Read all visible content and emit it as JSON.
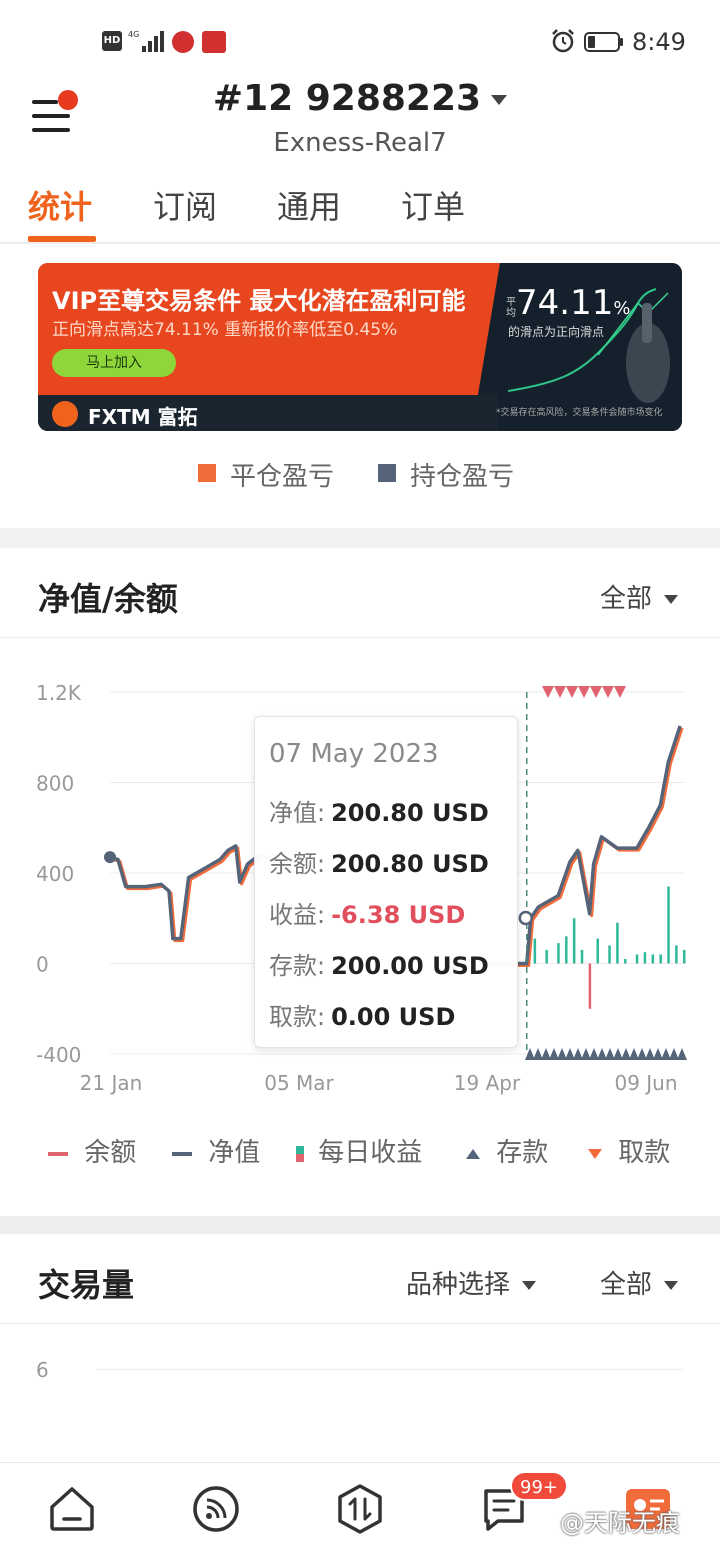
{
  "status_bar": {
    "hd": "HD",
    "net": "4G",
    "time": "8:49"
  },
  "header": {
    "account": "#12 9288223",
    "server": "Exness-Real7",
    "menu_has_notification": true
  },
  "tabs": [
    {
      "label": "统计",
      "active": true
    },
    {
      "label": "订阅",
      "active": false
    },
    {
      "label": "通用",
      "active": false
    },
    {
      "label": "订单",
      "active": false
    }
  ],
  "banner": {
    "title": "VIP至尊交易条件 最大化潜在盈利可能",
    "subtitle": "正向滑点高达74.11% 重新报价率低至0.45%",
    "cta": "马上加入",
    "brand": "FXTM 富拓",
    "pct_prefix": "平均",
    "pct": "74.11",
    "pct_unit": "%",
    "pct_desc": "的滑点为正向滑点",
    "disclaimer": "*交易存在高风险，交易条件会随市场变化"
  },
  "pnl_legend": [
    {
      "label": "平仓盈亏",
      "color": "#f26b3a"
    },
    {
      "label": "持仓盈亏",
      "color": "#56647a"
    }
  ],
  "equity_section": {
    "title": "净值/余额",
    "filter": "全部"
  },
  "tooltip": {
    "date": "07 May 2023",
    "rows": [
      {
        "label": "净值:",
        "value": "200.80 USD",
        "negative": false
      },
      {
        "label": "余额:",
        "value": "200.80 USD",
        "negative": false
      },
      {
        "label": "收益:",
        "value": "-6.38 USD",
        "negative": true
      },
      {
        "label": "存款:",
        "value": "200.00 USD",
        "negative": false
      },
      {
        "label": "取款:",
        "value": "0.00 USD",
        "negative": false
      }
    ]
  },
  "chart_legend": [
    {
      "label": "余额",
      "color": "#e0646e"
    },
    {
      "label": "净值",
      "color": "#56647a"
    },
    {
      "label": "每日收益",
      "color": "#2fb89a"
    },
    {
      "label": "存款",
      "color": "#56647a"
    },
    {
      "label": "取款",
      "color": "#f26b3a"
    }
  ],
  "volume_section": {
    "title": "交易量",
    "symbol_filter": "品种选择",
    "filter": "全部",
    "y_top": "6"
  },
  "bottom_nav": {
    "badge": "99+",
    "watermark": "@天际无痕"
  },
  "chart_data": {
    "type": "line",
    "title": "净值/余额",
    "y_ticks": [
      "1.2K",
      "800",
      "400",
      "0",
      "-400"
    ],
    "x_ticks": [
      "21 Jan",
      "05 Mar",
      "19 Apr",
      "09 Jun"
    ],
    "ylim": [
      -400,
      1200
    ],
    "series": [
      {
        "name": "净值",
        "x": [
          "2023-01-21",
          "2023-01-23",
          "2023-01-25",
          "2023-01-30",
          "2023-02-03",
          "2023-02-05",
          "2023-02-06",
          "2023-02-08",
          "2023-02-10",
          "2023-02-14",
          "2023-02-18",
          "2023-02-20",
          "2023-02-22",
          "2023-02-23",
          "2023-02-25",
          "2023-02-28",
          "2023-03-02",
          "2023-03-05"
        ],
        "values": [
          470,
          460,
          340,
          340,
          350,
          320,
          110,
          110,
          380,
          420,
          460,
          500,
          520,
          360,
          440,
          480,
          470,
          460
        ]
      },
      {
        "name": "净值",
        "x": [
          "2023-04-26",
          "2023-05-07",
          "2023-05-08",
          "2023-05-10",
          "2023-05-15",
          "2023-05-18",
          "2023-05-20",
          "2023-05-23",
          "2023-05-24",
          "2023-05-26",
          "2023-05-30",
          "2023-06-04",
          "2023-06-07",
          "2023-06-10",
          "2023-06-12",
          "2023-06-15"
        ],
        "values": [
          0,
          0,
          201,
          250,
          300,
          450,
          500,
          220,
          440,
          560,
          510,
          510,
          600,
          700,
          890,
          1050
        ]
      }
    ],
    "daily_profit": {
      "x": [
        "2023-05-07",
        "2023-05-09",
        "2023-05-12",
        "2023-05-15",
        "2023-05-17",
        "2023-05-19",
        "2023-05-21",
        "2023-05-23",
        "2023-05-25",
        "2023-05-28",
        "2023-05-30",
        "2023-06-01",
        "2023-06-04",
        "2023-06-06",
        "2023-06-08",
        "2023-06-10",
        "2023-06-12",
        "2023-06-14",
        "2023-06-16"
      ],
      "values": [
        -6,
        110,
        60,
        90,
        120,
        200,
        60,
        -200,
        110,
        80,
        180,
        20,
        40,
        50,
        40,
        40,
        340,
        80,
        60
      ]
    },
    "marker_date": "2023-05-07"
  }
}
